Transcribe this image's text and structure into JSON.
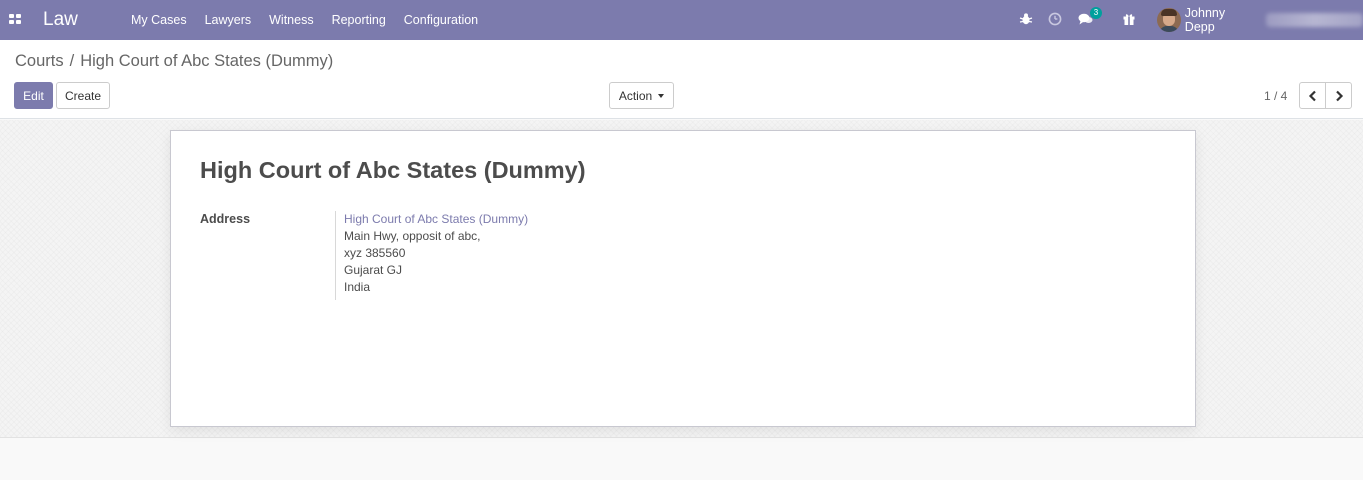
{
  "app": {
    "name": "Law"
  },
  "menu": [
    {
      "label": "My Cases"
    },
    {
      "label": "Lawyers"
    },
    {
      "label": "Witness"
    },
    {
      "label": "Reporting"
    },
    {
      "label": "Configuration"
    }
  ],
  "systray": {
    "icons": [
      "bug-icon",
      "clock-icon",
      "chat-icon",
      "gift-icon"
    ],
    "messages_badge": "3",
    "user_name": "Johnny Depp"
  },
  "breadcrumb": {
    "parent": "Courts",
    "separator": "/",
    "current": "High Court of Abc States (Dummy)"
  },
  "toolbar": {
    "edit_label": "Edit",
    "create_label": "Create",
    "action_label": "Action"
  },
  "pager": {
    "value": "1 / 4"
  },
  "record": {
    "name": "High Court of Abc States (Dummy)",
    "address_label": "Address",
    "address": {
      "name": "High Court of Abc States (Dummy)",
      "street": "Main Hwy, opposit of abc,",
      "city_zip": "xyz 385560",
      "state": "Gujarat GJ",
      "country": "India"
    }
  },
  "colors": {
    "navbar": "#7c7bad",
    "primary": "#7c7bad",
    "badge": "#00a09d"
  }
}
